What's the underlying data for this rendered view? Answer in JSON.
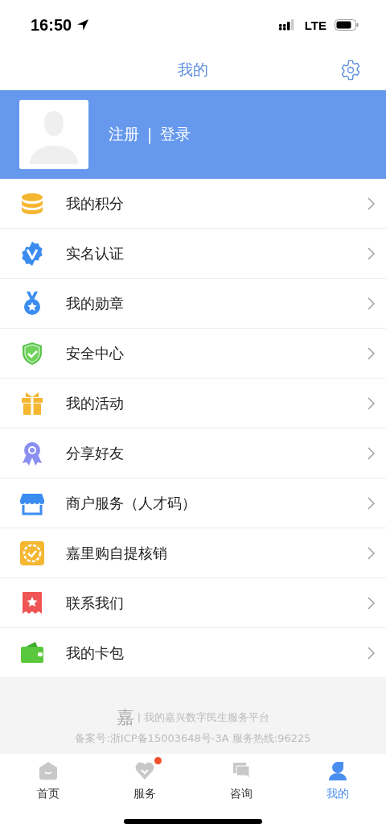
{
  "status_bar": {
    "time": "16:50",
    "network": "LTE"
  },
  "nav": {
    "title": "我的"
  },
  "profile": {
    "register": "注册",
    "separator": "|",
    "login": "登录"
  },
  "menu": [
    {
      "label": "我的积分",
      "kind": "coins"
    },
    {
      "label": "实名认证",
      "kind": "verified"
    },
    {
      "label": "我的勋章",
      "kind": "medal"
    },
    {
      "label": "安全中心",
      "kind": "shield"
    },
    {
      "label": "我的活动",
      "kind": "gift"
    },
    {
      "label": "分享好友",
      "kind": "ribbon"
    },
    {
      "label": "商户服务（人才码）",
      "kind": "store"
    },
    {
      "label": "嘉里购自提核销",
      "kind": "badge"
    },
    {
      "label": "联系我们",
      "kind": "ticket"
    },
    {
      "label": "我的卡包",
      "kind": "wallet"
    }
  ],
  "footer": {
    "logo": "嘉",
    "slogan": "| 我的嘉兴数字民生服务平台",
    "record": "备案号:浙ICP备15003648号-3A 服务热线:96225"
  },
  "tabs": [
    {
      "label": "首页",
      "kind": "home",
      "selected": false,
      "badge": false
    },
    {
      "label": "服务",
      "kind": "heart",
      "selected": false,
      "badge": true
    },
    {
      "label": "咨询",
      "kind": "chat",
      "selected": false,
      "badge": false
    },
    {
      "label": "我的",
      "kind": "person",
      "selected": true,
      "badge": false
    }
  ]
}
